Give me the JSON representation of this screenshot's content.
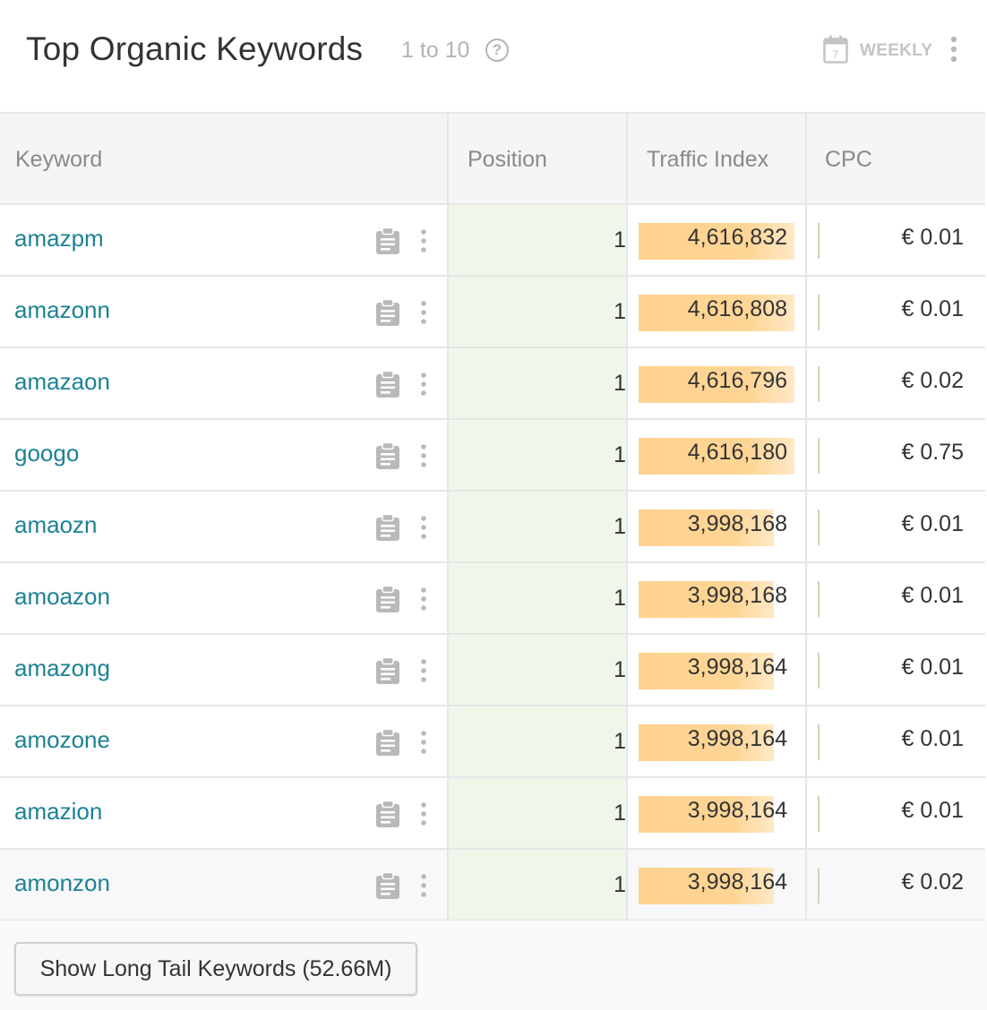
{
  "header": {
    "title": "Top Organic Keywords",
    "range": "1 to 10",
    "help_symbol": "?",
    "calendar_day": "7",
    "period": "WEEKLY"
  },
  "table": {
    "columns": [
      "Keyword",
      "Position",
      "Traffic Index",
      "CPC"
    ],
    "rows": [
      {
        "keyword": "amazpm",
        "position": "1",
        "traffic": "4,616,832",
        "traffic_share": 1.0,
        "cpc": "€ 0.01"
      },
      {
        "keyword": "amazonn",
        "position": "1",
        "traffic": "4,616,808",
        "traffic_share": 1.0,
        "cpc": "€ 0.01"
      },
      {
        "keyword": "amazaon",
        "position": "1",
        "traffic": "4,616,796",
        "traffic_share": 1.0,
        "cpc": "€ 0.02"
      },
      {
        "keyword": "googo",
        "position": "1",
        "traffic": "4,616,180",
        "traffic_share": 1.0,
        "cpc": "€ 0.75"
      },
      {
        "keyword": "amaozn",
        "position": "1",
        "traffic": "3,998,168",
        "traffic_share": 0.866,
        "cpc": "€ 0.01"
      },
      {
        "keyword": "amoazon",
        "position": "1",
        "traffic": "3,998,168",
        "traffic_share": 0.866,
        "cpc": "€ 0.01"
      },
      {
        "keyword": "amazong",
        "position": "1",
        "traffic": "3,998,164",
        "traffic_share": 0.866,
        "cpc": "€ 0.01"
      },
      {
        "keyword": "amozone",
        "position": "1",
        "traffic": "3,998,164",
        "traffic_share": 0.866,
        "cpc": "€ 0.01"
      },
      {
        "keyword": "amazion",
        "position": "1",
        "traffic": "3,998,164",
        "traffic_share": 0.866,
        "cpc": "€ 0.01"
      },
      {
        "keyword": "amonzon",
        "position": "1",
        "traffic": "3,998,164",
        "traffic_share": 0.866,
        "cpc": "€ 0.02"
      }
    ]
  },
  "footer": {
    "long_tail_label": "Show Long Tail Keywords (52.66M)"
  },
  "colors": {
    "keyword_link": "#1b8296",
    "traffic_bar": "#ffd28f",
    "position_bg": "#f1f6eb"
  },
  "icons": {
    "help": "help-circle-icon",
    "calendar": "calendar-icon",
    "menu": "more-vertical-icon",
    "clipboard": "clipboard-icon"
  }
}
